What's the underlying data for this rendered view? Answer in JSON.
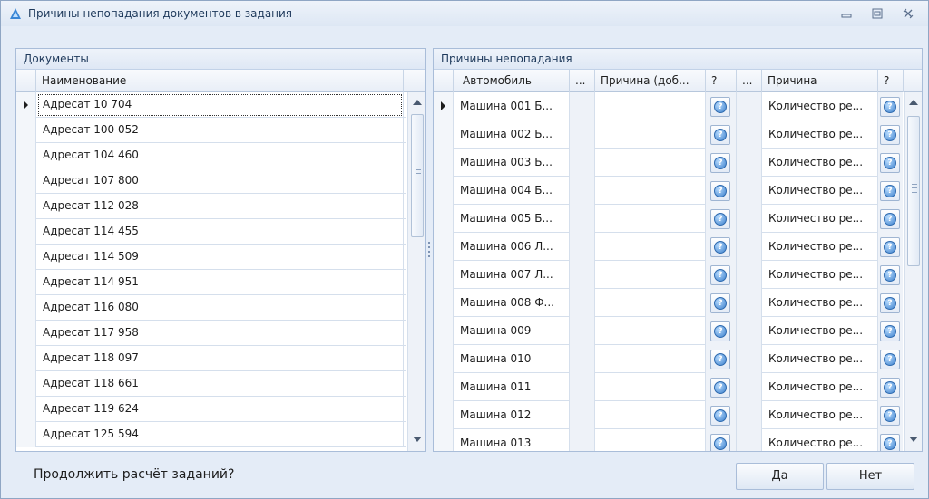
{
  "window": {
    "title": "Причины непопадания документов в задания",
    "min_symbol": "▭",
    "max_symbol": "▢",
    "close_symbol": "✕"
  },
  "documents": {
    "panel_title": "Документы",
    "column": "Наименование",
    "rows": [
      "Адресат 10 704",
      "Адресат 100 052",
      "Адресат 104 460",
      "Адресат 107 800",
      "Адресат 112 028",
      "Адресат 114 455",
      "Адресат 114 509",
      "Адресат 114 951",
      "Адресат 116 080",
      "Адресат 117 958",
      "Адресат 118 097",
      "Адресат 118 661",
      "Адресат 119 624",
      "Адресат 125 594"
    ]
  },
  "reasons": {
    "panel_title": "Причины непопадания",
    "columns": {
      "car": "Автомобиль",
      "dots1": "...",
      "reason_add": "Причина (доб...",
      "q1": "?",
      "dots2": "...",
      "reason": "Причина",
      "q2": "?"
    },
    "question_glyph": "?",
    "rows": [
      {
        "car": "Машина 001 Б...",
        "reason": "Количество ре..."
      },
      {
        "car": "Машина 002 Б...",
        "reason": "Количество ре..."
      },
      {
        "car": "Машина 003 Б...",
        "reason": "Количество ре..."
      },
      {
        "car": "Машина 004 Б...",
        "reason": "Количество ре..."
      },
      {
        "car": "Машина 005 Б...",
        "reason": "Количество ре..."
      },
      {
        "car": "Машина 006 Л...",
        "reason": "Количество ре..."
      },
      {
        "car": "Машина 007 Л...",
        "reason": "Количество ре..."
      },
      {
        "car": "Машина 008 Ф...",
        "reason": "Количество ре..."
      },
      {
        "car": "Машина 009",
        "reason": "Количество ре..."
      },
      {
        "car": "Машина 010",
        "reason": "Количество ре..."
      },
      {
        "car": "Машина 011",
        "reason": "Количество ре..."
      },
      {
        "car": "Машина 012",
        "reason": "Количество ре..."
      },
      {
        "car": "Машина 013",
        "reason": "Количество ре..."
      }
    ]
  },
  "footer": {
    "prompt": "Продолжить расчёт заданий?",
    "yes": "Да",
    "no": "Нет"
  },
  "colors": {
    "accent": "#2f6bb0",
    "frame": "#e4ecf7",
    "title_text": "#1e395b"
  },
  "icons": {
    "app": "blue-triangle-logo-icon",
    "row_pointer": "row-pointer-icon",
    "question": "question-circle-icon"
  }
}
